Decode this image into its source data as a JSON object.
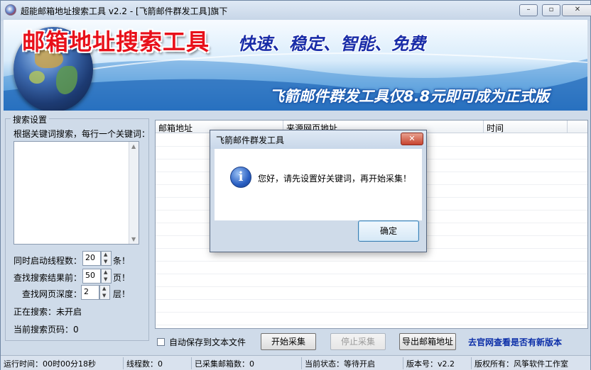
{
  "window": {
    "title": "超能邮箱地址搜索工具 v2.2 - [飞箭邮件群发工具]旗下",
    "controls": {
      "minimize": "–",
      "restore": "▫",
      "close": "✕"
    }
  },
  "banner": {
    "title": "邮箱地址搜索工具",
    "slogan": "快速、稳定、智能、免费",
    "ad": "飞箭邮件群发工具仅8.8元即可成为正式版"
  },
  "search": {
    "group_title": "搜索设置",
    "keyword_label": "根据关键词搜索，每行一个关键词：",
    "keywords_value": "",
    "threads_label": "同时启动线程数：",
    "threads_value": "20",
    "threads_unit": "条！",
    "pages_label": "查找搜索结果前：",
    "pages_value": "50",
    "pages_unit": "页！",
    "depth_label": "查找网页深度：",
    "depth_value": "2",
    "depth_unit": "层！",
    "searching_label": "正在搜索：未开启",
    "current_page_label": "当前搜索页码：0"
  },
  "table": {
    "columns": [
      "邮箱地址",
      "来源网页地址",
      "时间"
    ],
    "rows": []
  },
  "controls": {
    "autosave_label": "自动保存到文本文件",
    "autosave_checked": false,
    "start_label": "开始采集",
    "stop_label": "停止采集",
    "export_label": "导出邮箱地址",
    "official_link": "去官网查看是否有新版本"
  },
  "status": {
    "runtime": "运行时间：00时00分18秒",
    "threads": "线程数：0",
    "collected": "已采集邮箱数：0",
    "state": "当前状态：等待开启",
    "version": "版本号：v2.2",
    "copyright": "版权所有：风筝软件工作室"
  },
  "dialog": {
    "title": "飞箭邮件群发工具",
    "message": "您好，请先设置好关键词，再开始采集！",
    "ok_label": "确定",
    "close_label": "✕"
  },
  "icons": {
    "app": "app-globe-icon",
    "info": "info-icon",
    "spin_up": "▲",
    "spin_down": "▼"
  }
}
